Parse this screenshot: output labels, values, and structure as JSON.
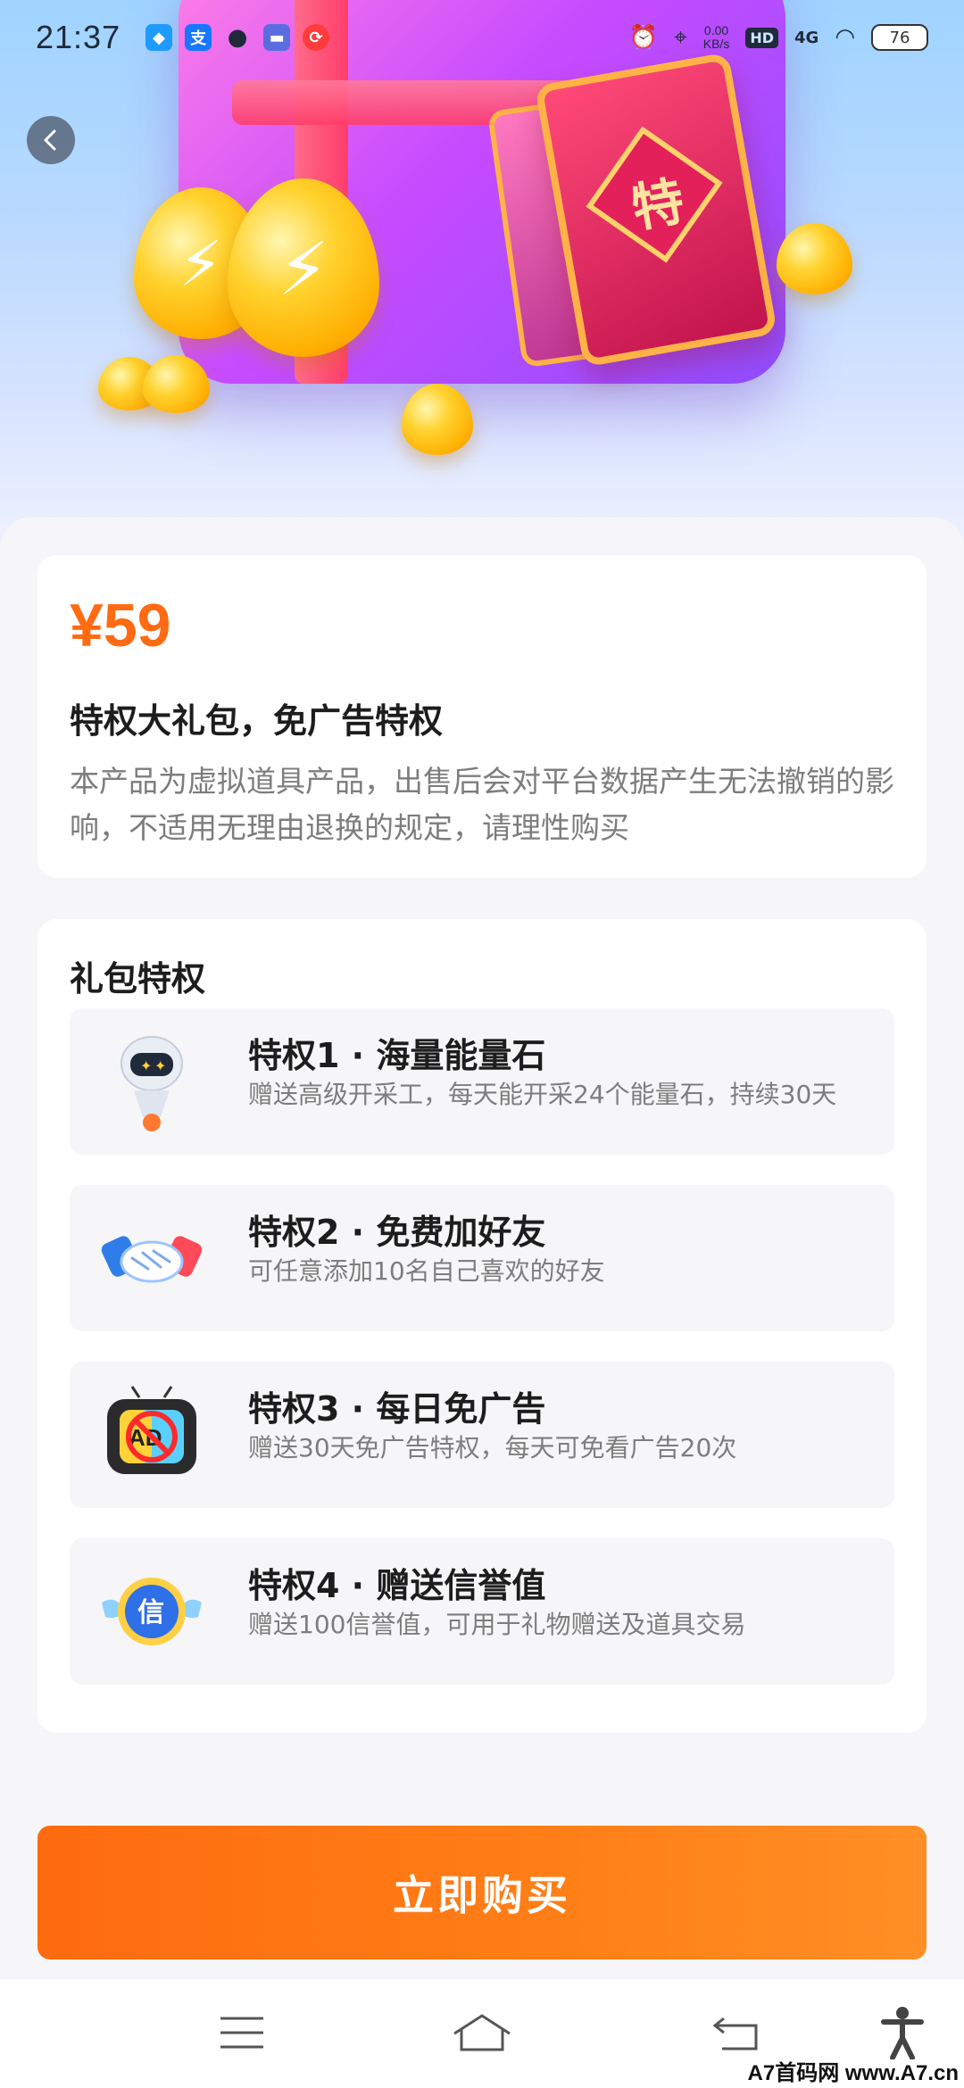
{
  "status_bar": {
    "time": "21:37",
    "net_speed_value": "0.00",
    "net_speed_unit": "KB/s",
    "hd_label": "HD",
    "signal_label": "4G",
    "battery_level": "76",
    "left_icons": [
      "dingtalk-icon",
      "alipay-icon",
      "qq-icon",
      "car-icon",
      "scooter-icon"
    ],
    "right_icons": [
      "alarm-icon",
      "location-icon",
      "wifi-icon"
    ]
  },
  "hero": {
    "card_char": "特"
  },
  "product": {
    "price": "¥59",
    "title": "特权大礼包，免广告特权",
    "description": "本产品为虚拟道具产品，出售后会对平台数据产生无法撤销的影响，不适用无理由退换的规定，请理性购买"
  },
  "privileges": {
    "section_title": "礼包特权",
    "items": [
      {
        "title": "特权1 · 海量能量石",
        "desc": "赠送高级开采工，每天能开采24个能量石，持续30天",
        "icon": "robot-icon"
      },
      {
        "title": "特权2 · 免费加好友",
        "desc": "可任意添加10名自己喜欢的好友",
        "icon": "handshake-icon"
      },
      {
        "title": "特权3 · 每日免广告",
        "desc": "赠送30天免广告特权，每天可免看广告20次",
        "icon": "no-ad-tv-icon"
      },
      {
        "title": "特权4 · 赠送信誉值",
        "desc": "赠送100信誉值，可用于礼物赠送及道具交易",
        "icon": "credit-badge-icon",
        "badge_char": "信"
      }
    ]
  },
  "buy_button": {
    "label": "立即购买"
  },
  "watermark": "A7首码网 www.A7.cn",
  "colors": {
    "accent": "#ff6a12",
    "button_start": "#ff6b10",
    "button_end": "#ff8f26",
    "sheet_bg": "#f6f6f8"
  }
}
